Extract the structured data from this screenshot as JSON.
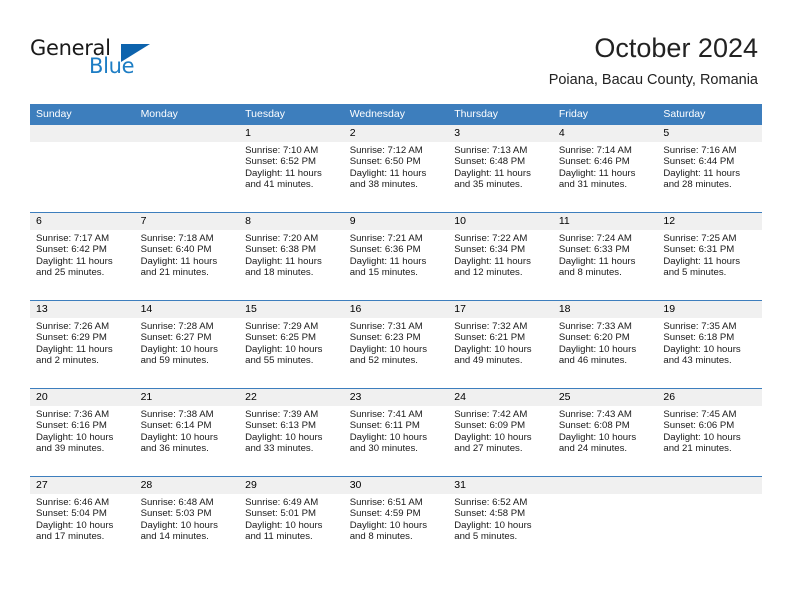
{
  "brand": {
    "name_top": "General",
    "name_bottom": "Blue",
    "accent_color": "#0d63ad",
    "blue_text_color": "#1d7dc4"
  },
  "header": {
    "month_title": "October 2024",
    "location": "Poiana, Bacau County, Romania"
  },
  "theme": {
    "header_row_bg": "#3d7ebd",
    "day_number_bg": "#f0f0f0",
    "text_color": "#000000"
  },
  "weekdays": [
    "Sunday",
    "Monday",
    "Tuesday",
    "Wednesday",
    "Thursday",
    "Friday",
    "Saturday"
  ],
  "labels": {
    "sunrise_prefix": "Sunrise:",
    "sunset_prefix": "Sunset:",
    "daylight_prefix": "Daylight:"
  },
  "weeks": [
    [
      {
        "day": "",
        "empty": true,
        "sunrise": "",
        "sunset": "",
        "daylight_a": "",
        "daylight_b": ""
      },
      {
        "day": "",
        "empty": true,
        "sunrise": "",
        "sunset": "",
        "daylight_a": "",
        "daylight_b": ""
      },
      {
        "day": "1",
        "empty": false,
        "sunrise": "Sunrise: 7:10 AM",
        "sunset": "Sunset: 6:52 PM",
        "daylight_a": "Daylight: 11 hours",
        "daylight_b": "and 41 minutes."
      },
      {
        "day": "2",
        "empty": false,
        "sunrise": "Sunrise: 7:12 AM",
        "sunset": "Sunset: 6:50 PM",
        "daylight_a": "Daylight: 11 hours",
        "daylight_b": "and 38 minutes."
      },
      {
        "day": "3",
        "empty": false,
        "sunrise": "Sunrise: 7:13 AM",
        "sunset": "Sunset: 6:48 PM",
        "daylight_a": "Daylight: 11 hours",
        "daylight_b": "and 35 minutes."
      },
      {
        "day": "4",
        "empty": false,
        "sunrise": "Sunrise: 7:14 AM",
        "sunset": "Sunset: 6:46 PM",
        "daylight_a": "Daylight: 11 hours",
        "daylight_b": "and 31 minutes."
      },
      {
        "day": "5",
        "empty": false,
        "sunrise": "Sunrise: 7:16 AM",
        "sunset": "Sunset: 6:44 PM",
        "daylight_a": "Daylight: 11 hours",
        "daylight_b": "and 28 minutes."
      }
    ],
    [
      {
        "day": "6",
        "empty": false,
        "sunrise": "Sunrise: 7:17 AM",
        "sunset": "Sunset: 6:42 PM",
        "daylight_a": "Daylight: 11 hours",
        "daylight_b": "and 25 minutes."
      },
      {
        "day": "7",
        "empty": false,
        "sunrise": "Sunrise: 7:18 AM",
        "sunset": "Sunset: 6:40 PM",
        "daylight_a": "Daylight: 11 hours",
        "daylight_b": "and 21 minutes."
      },
      {
        "day": "8",
        "empty": false,
        "sunrise": "Sunrise: 7:20 AM",
        "sunset": "Sunset: 6:38 PM",
        "daylight_a": "Daylight: 11 hours",
        "daylight_b": "and 18 minutes."
      },
      {
        "day": "9",
        "empty": false,
        "sunrise": "Sunrise: 7:21 AM",
        "sunset": "Sunset: 6:36 PM",
        "daylight_a": "Daylight: 11 hours",
        "daylight_b": "and 15 minutes."
      },
      {
        "day": "10",
        "empty": false,
        "sunrise": "Sunrise: 7:22 AM",
        "sunset": "Sunset: 6:34 PM",
        "daylight_a": "Daylight: 11 hours",
        "daylight_b": "and 12 minutes."
      },
      {
        "day": "11",
        "empty": false,
        "sunrise": "Sunrise: 7:24 AM",
        "sunset": "Sunset: 6:33 PM",
        "daylight_a": "Daylight: 11 hours",
        "daylight_b": "and 8 minutes."
      },
      {
        "day": "12",
        "empty": false,
        "sunrise": "Sunrise: 7:25 AM",
        "sunset": "Sunset: 6:31 PM",
        "daylight_a": "Daylight: 11 hours",
        "daylight_b": "and 5 minutes."
      }
    ],
    [
      {
        "day": "13",
        "empty": false,
        "sunrise": "Sunrise: 7:26 AM",
        "sunset": "Sunset: 6:29 PM",
        "daylight_a": "Daylight: 11 hours",
        "daylight_b": "and 2 minutes."
      },
      {
        "day": "14",
        "empty": false,
        "sunrise": "Sunrise: 7:28 AM",
        "sunset": "Sunset: 6:27 PM",
        "daylight_a": "Daylight: 10 hours",
        "daylight_b": "and 59 minutes."
      },
      {
        "day": "15",
        "empty": false,
        "sunrise": "Sunrise: 7:29 AM",
        "sunset": "Sunset: 6:25 PM",
        "daylight_a": "Daylight: 10 hours",
        "daylight_b": "and 55 minutes."
      },
      {
        "day": "16",
        "empty": false,
        "sunrise": "Sunrise: 7:31 AM",
        "sunset": "Sunset: 6:23 PM",
        "daylight_a": "Daylight: 10 hours",
        "daylight_b": "and 52 minutes."
      },
      {
        "day": "17",
        "empty": false,
        "sunrise": "Sunrise: 7:32 AM",
        "sunset": "Sunset: 6:21 PM",
        "daylight_a": "Daylight: 10 hours",
        "daylight_b": "and 49 minutes."
      },
      {
        "day": "18",
        "empty": false,
        "sunrise": "Sunrise: 7:33 AM",
        "sunset": "Sunset: 6:20 PM",
        "daylight_a": "Daylight: 10 hours",
        "daylight_b": "and 46 minutes."
      },
      {
        "day": "19",
        "empty": false,
        "sunrise": "Sunrise: 7:35 AM",
        "sunset": "Sunset: 6:18 PM",
        "daylight_a": "Daylight: 10 hours",
        "daylight_b": "and 43 minutes."
      }
    ],
    [
      {
        "day": "20",
        "empty": false,
        "sunrise": "Sunrise: 7:36 AM",
        "sunset": "Sunset: 6:16 PM",
        "daylight_a": "Daylight: 10 hours",
        "daylight_b": "and 39 minutes."
      },
      {
        "day": "21",
        "empty": false,
        "sunrise": "Sunrise: 7:38 AM",
        "sunset": "Sunset: 6:14 PM",
        "daylight_a": "Daylight: 10 hours",
        "daylight_b": "and 36 minutes."
      },
      {
        "day": "22",
        "empty": false,
        "sunrise": "Sunrise: 7:39 AM",
        "sunset": "Sunset: 6:13 PM",
        "daylight_a": "Daylight: 10 hours",
        "daylight_b": "and 33 minutes."
      },
      {
        "day": "23",
        "empty": false,
        "sunrise": "Sunrise: 7:41 AM",
        "sunset": "Sunset: 6:11 PM",
        "daylight_a": "Daylight: 10 hours",
        "daylight_b": "and 30 minutes."
      },
      {
        "day": "24",
        "empty": false,
        "sunrise": "Sunrise: 7:42 AM",
        "sunset": "Sunset: 6:09 PM",
        "daylight_a": "Daylight: 10 hours",
        "daylight_b": "and 27 minutes."
      },
      {
        "day": "25",
        "empty": false,
        "sunrise": "Sunrise: 7:43 AM",
        "sunset": "Sunset: 6:08 PM",
        "daylight_a": "Daylight: 10 hours",
        "daylight_b": "and 24 minutes."
      },
      {
        "day": "26",
        "empty": false,
        "sunrise": "Sunrise: 7:45 AM",
        "sunset": "Sunset: 6:06 PM",
        "daylight_a": "Daylight: 10 hours",
        "daylight_b": "and 21 minutes."
      }
    ],
    [
      {
        "day": "27",
        "empty": false,
        "sunrise": "Sunrise: 6:46 AM",
        "sunset": "Sunset: 5:04 PM",
        "daylight_a": "Daylight: 10 hours",
        "daylight_b": "and 17 minutes."
      },
      {
        "day": "28",
        "empty": false,
        "sunrise": "Sunrise: 6:48 AM",
        "sunset": "Sunset: 5:03 PM",
        "daylight_a": "Daylight: 10 hours",
        "daylight_b": "and 14 minutes."
      },
      {
        "day": "29",
        "empty": false,
        "sunrise": "Sunrise: 6:49 AM",
        "sunset": "Sunset: 5:01 PM",
        "daylight_a": "Daylight: 10 hours",
        "daylight_b": "and 11 minutes."
      },
      {
        "day": "30",
        "empty": false,
        "sunrise": "Sunrise: 6:51 AM",
        "sunset": "Sunset: 4:59 PM",
        "daylight_a": "Daylight: 10 hours",
        "daylight_b": "and 8 minutes."
      },
      {
        "day": "31",
        "empty": false,
        "sunrise": "Sunrise: 6:52 AM",
        "sunset": "Sunset: 4:58 PM",
        "daylight_a": "Daylight: 10 hours",
        "daylight_b": "and 5 minutes."
      },
      {
        "day": "",
        "empty": true,
        "sunrise": "",
        "sunset": "",
        "daylight_a": "",
        "daylight_b": ""
      },
      {
        "day": "",
        "empty": true,
        "sunrise": "",
        "sunset": "",
        "daylight_a": "",
        "daylight_b": ""
      }
    ]
  ]
}
